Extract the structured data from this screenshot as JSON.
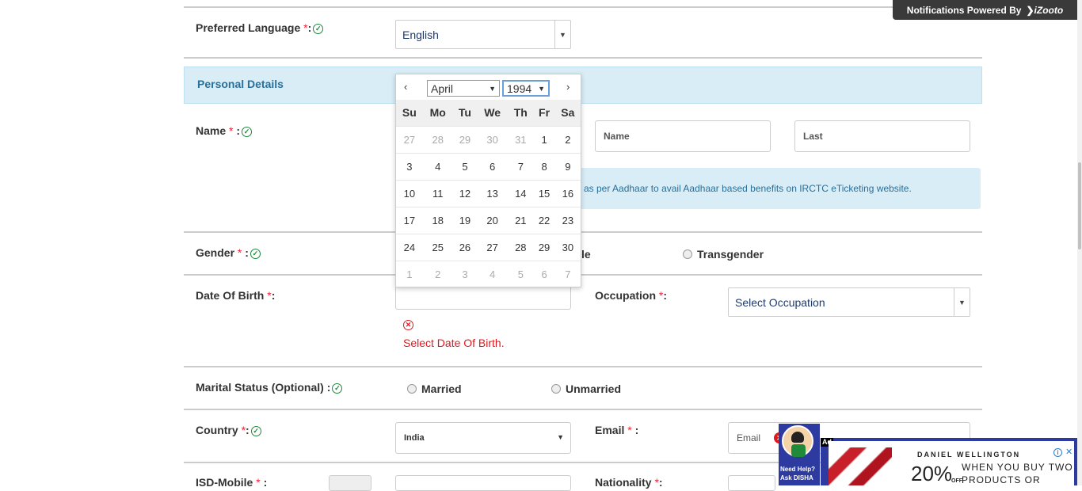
{
  "notification": {
    "text": "Notifications Powered By",
    "brand": "iZooto"
  },
  "preferred_language": {
    "label": "Preferred Language",
    "required": "*",
    "colon": ":",
    "value": "English"
  },
  "personal_details": {
    "title": "Personal Details"
  },
  "name": {
    "label": "Name",
    "required": "*",
    "colon": ":",
    "first_placeholder": "Name",
    "last_placeholder": "Last"
  },
  "aadhaar_info": {
    "text": "as per Aadhaar to avail Aadhaar based benefits on IRCTC eTicketing website."
  },
  "gender": {
    "label": "Gender",
    "required": "*",
    "colon": ":",
    "partial_option": "le",
    "option_transgender": "Transgender"
  },
  "dob": {
    "label": "Date Of Birth",
    "required": "*",
    "colon": ":",
    "error": "Select Date Of Birth."
  },
  "occupation": {
    "label": "Occupation",
    "required": "*",
    "colon": ":",
    "value": "Select Occupation"
  },
  "marital": {
    "label": "Marital Status (Optional)",
    "colon": ":",
    "option_married": "Married",
    "option_unmarried": "Unmarried"
  },
  "country": {
    "label": "Country",
    "required": "*",
    "colon": ":",
    "value": "India"
  },
  "email": {
    "label": "Email",
    "required": "*",
    "colon": ":",
    "placeholder": "Email"
  },
  "isd": {
    "label": "ISD-Mobile",
    "required": "*",
    "colon": ":"
  },
  "nationality": {
    "label": "Nationality",
    "required": "*",
    "colon": ":"
  },
  "calendar": {
    "month": "April",
    "year": "1994",
    "prev": "‹",
    "next": "›",
    "weekdays": [
      "Su",
      "Mo",
      "Tu",
      "We",
      "Th",
      "Fr",
      "Sa"
    ],
    "weeks": [
      [
        {
          "d": "27",
          "m": true
        },
        {
          "d": "28",
          "m": true
        },
        {
          "d": "29",
          "m": true
        },
        {
          "d": "30",
          "m": true
        },
        {
          "d": "31",
          "m": true
        },
        {
          "d": "1",
          "m": false
        },
        {
          "d": "2",
          "m": false
        }
      ],
      [
        {
          "d": "3",
          "m": false
        },
        {
          "d": "4",
          "m": false
        },
        {
          "d": "5",
          "m": false
        },
        {
          "d": "6",
          "m": false
        },
        {
          "d": "7",
          "m": false
        },
        {
          "d": "8",
          "m": false
        },
        {
          "d": "9",
          "m": false
        }
      ],
      [
        {
          "d": "10",
          "m": false
        },
        {
          "d": "11",
          "m": false
        },
        {
          "d": "12",
          "m": false
        },
        {
          "d": "13",
          "m": false
        },
        {
          "d": "14",
          "m": false
        },
        {
          "d": "15",
          "m": false
        },
        {
          "d": "16",
          "m": false
        }
      ],
      [
        {
          "d": "17",
          "m": false
        },
        {
          "d": "18",
          "m": false
        },
        {
          "d": "19",
          "m": false
        },
        {
          "d": "20",
          "m": false
        },
        {
          "d": "21",
          "m": false
        },
        {
          "d": "22",
          "m": false
        },
        {
          "d": "23",
          "m": false
        }
      ],
      [
        {
          "d": "24",
          "m": false
        },
        {
          "d": "25",
          "m": false
        },
        {
          "d": "26",
          "m": false
        },
        {
          "d": "27",
          "m": false
        },
        {
          "d": "28",
          "m": false
        },
        {
          "d": "29",
          "m": false
        },
        {
          "d": "30",
          "m": false
        }
      ],
      [
        {
          "d": "1",
          "m": true
        },
        {
          "d": "2",
          "m": true
        },
        {
          "d": "3",
          "m": true
        },
        {
          "d": "4",
          "m": true
        },
        {
          "d": "5",
          "m": true
        },
        {
          "d": "6",
          "m": true
        },
        {
          "d": "7",
          "m": true
        }
      ]
    ]
  },
  "disha": {
    "line1": "Need Help?",
    "line2": "Ask DISHA"
  },
  "ad": {
    "badge": "Ad",
    "brand": "DANIEL WELLINGTON",
    "offer": "20%",
    "off": "OFF",
    "text1": "WHEN YOU BUY TWO",
    "text2": "PRODUCTS OR MORE"
  },
  "colors": {
    "accent": "#2a6f97",
    "info_bg": "#d9edf7",
    "error": "#e0191f",
    "ad_blue": "#2d3aa0"
  }
}
